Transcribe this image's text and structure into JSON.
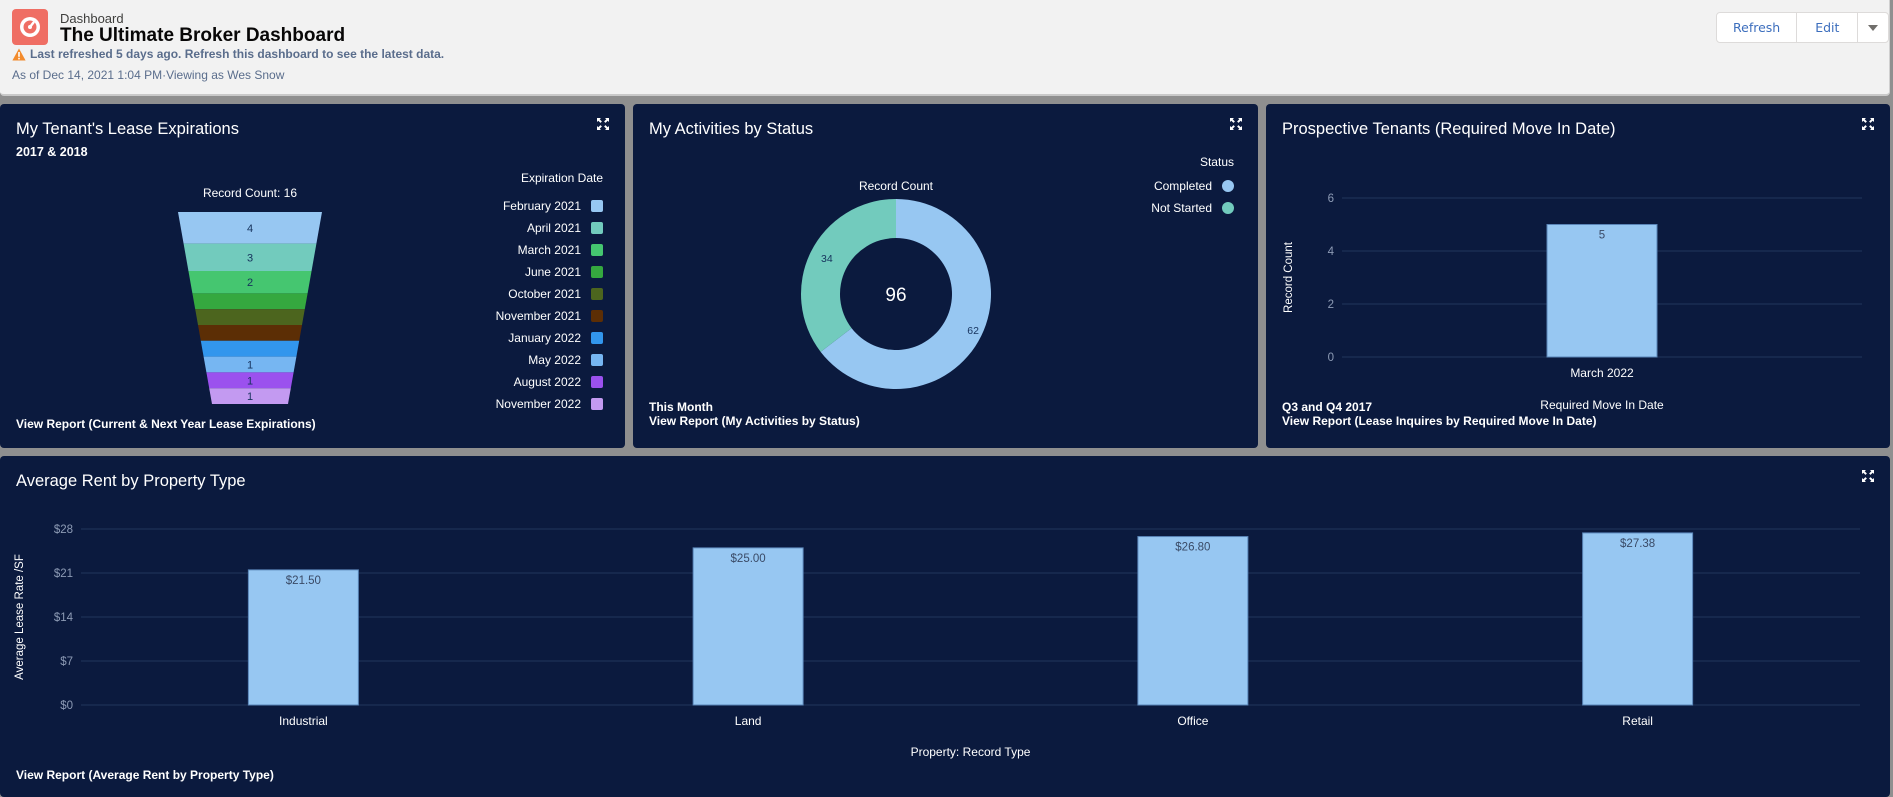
{
  "header": {
    "eyebrow": "Dashboard",
    "title": "The Ultimate Broker Dashboard",
    "warning": "Last refreshed 5 days ago. Refresh this dashboard to see the latest data.",
    "as_of": "As of Dec 14, 2021 1:04 PM·Viewing as Wes Snow",
    "buttons": {
      "refresh": "Refresh",
      "edit": "Edit"
    },
    "icon": "dashboard-gauge-icon",
    "accent": "#ef6e64"
  },
  "panels": {
    "lease": {
      "title": "My Tenant's Lease Expirations",
      "subtitle": "2017 & 2018",
      "chart_label": "Record Count: 16",
      "legend_title": "Expiration Date",
      "footer": "View Report (Current & Next Year Lease Expirations)"
    },
    "activities": {
      "title": "My Activities by Status",
      "chart_label": "Record Count",
      "center_total": "96",
      "legend_title": "Status",
      "filter": "This Month",
      "footer": "View Report (My Activities by Status)"
    },
    "prospects": {
      "title": "Prospective Tenants (Required Move In Date)",
      "filter": "Q3 and Q4 2017",
      "footer": "View Report (Lease Inquires by Required Move In Date)"
    },
    "rent": {
      "title": "Average Rent by Property Type",
      "footer": "View Report (Average Rent by Property Type)"
    }
  },
  "chart_data": [
    {
      "id": "lease",
      "type": "funnel",
      "title": "My Tenant's Lease Expirations",
      "measure": "Record Count",
      "total": 16,
      "legend_title": "Expiration Date",
      "legend_position": "right",
      "categories": [
        "February 2021",
        "April 2021",
        "March 2021",
        "June 2021",
        "October 2021",
        "November 2021",
        "January 2022",
        "May 2022",
        "August 2022",
        "November 2022"
      ],
      "values": [
        4,
        3,
        2,
        1,
        1,
        1,
        1,
        1,
        1,
        1
      ],
      "labels_shown": [
        "4",
        "3",
        "2",
        "",
        "",
        "",
        "",
        "1",
        "1",
        "1"
      ],
      "colors": [
        "#97c7f2",
        "#72cbbd",
        "#45c670",
        "#35a83f",
        "#4c651e",
        "#5c2e05",
        "#3296ed",
        "#76b6f2",
        "#9b51ee",
        "#c39af1"
      ]
    },
    {
      "id": "activities",
      "type": "donut",
      "title": "My Activities by Status",
      "measure": "Record Count",
      "total": 96,
      "legend_title": "Status",
      "legend_position": "top-right",
      "categories": [
        "Completed",
        "Not Started"
      ],
      "values": [
        62,
        34
      ],
      "colors": [
        "#97c7f2",
        "#72cbbd"
      ]
    },
    {
      "id": "prospects",
      "type": "bar",
      "title": "Prospective Tenants (Required Move In Date)",
      "categories": [
        "March 2022"
      ],
      "values": [
        5
      ],
      "value_labels": [
        "5"
      ],
      "xlabel": "Required Move In Date",
      "ylabel": "Record Count",
      "ylim": [
        0,
        6
      ],
      "yticks": [
        0,
        2,
        4,
        6
      ],
      "ytick_labels": [
        "0",
        "2",
        "4",
        "6"
      ],
      "grid": true,
      "color": "#97c7f2"
    },
    {
      "id": "rent",
      "type": "bar",
      "title": "Average Rent by Property Type",
      "categories": [
        "Industrial",
        "Land",
        "Office",
        "Retail"
      ],
      "values": [
        21.5,
        25.0,
        26.8,
        27.38
      ],
      "value_labels": [
        "$21.50",
        "$25.00",
        "$26.80",
        "$27.38"
      ],
      "xlabel": "Property: Record Type",
      "ylabel": "Average Lease Rate /SF",
      "ylim": [
        0,
        28
      ],
      "yticks": [
        0,
        7,
        14,
        21,
        28
      ],
      "ytick_labels": [
        "$0",
        "$7",
        "$14",
        "$21",
        "$28"
      ],
      "grid": true,
      "color": "#97c7f2"
    }
  ],
  "theme": {
    "panel_bg": "#0b1a3e",
    "gridline": "#22355c",
    "tick_text": "#8d9bb5",
    "bar_border": "#5a85b8"
  }
}
